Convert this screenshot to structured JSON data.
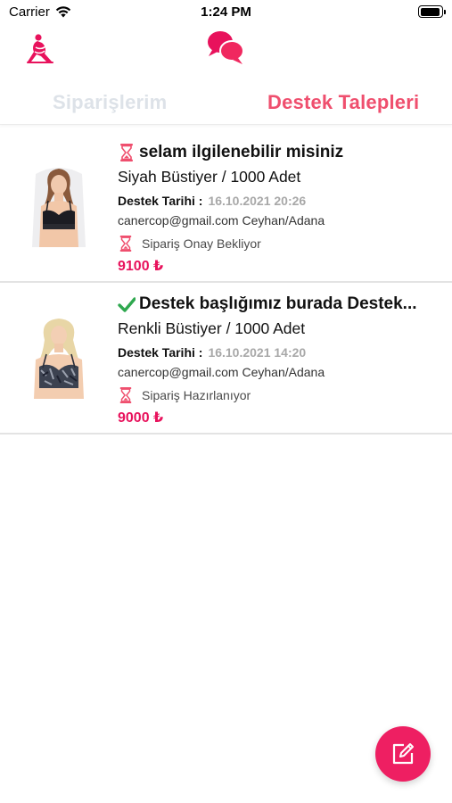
{
  "status_bar": {
    "carrier": "Carrier",
    "time": "1:24 PM",
    "battery_level": 0.8
  },
  "nav": {
    "logo_icon": "fitness-woman-logo-icon",
    "chat_icon": "chat-bubbles-icon",
    "accent": "#ef4f6e"
  },
  "tabs": [
    {
      "label": "Siparişlerim",
      "selected": false
    },
    {
      "label": "Destek Talepleri",
      "selected": true
    }
  ],
  "tickets": [
    {
      "status_icon": "hourglass-icon",
      "title": "selam ilgilenebilir misiniz",
      "product": "Siyah Büstiyer / 1000 Adet",
      "date_label": "Destek Tarihi :",
      "date": "16.10.2021 20:26",
      "contact": "canercop@gmail.com Ceyhan/Adana",
      "order_status_icon": "hourglass-icon",
      "order_status": "Sipariş Onay Bekliyor",
      "price": "9100 ₺"
    },
    {
      "status_icon": "checkmark-icon",
      "title": "Destek başlığımız burada Destek...",
      "product": "Renkli Büstiyer / 1000 Adet",
      "date_label": "Destek Tarihi :",
      "date": "16.10.2021 14:20",
      "contact": "canercop@gmail.com Ceyhan/Adana",
      "order_status_icon": "hourglass-icon",
      "order_status": "Sipariş Hazırlanıyor",
      "price": "9000 ₺"
    }
  ],
  "fab": {
    "icon": "compose-icon",
    "color": "#ee1f62"
  }
}
